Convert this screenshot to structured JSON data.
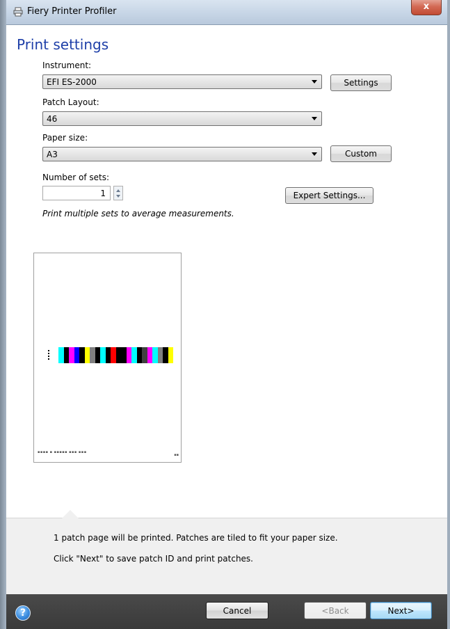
{
  "window": {
    "title": "Fiery Printer Profiler",
    "close_glyph": "x"
  },
  "page": {
    "title": "Print settings"
  },
  "instrument": {
    "label": "Instrument:",
    "value": "EFI ES-2000",
    "settings_button": "Settings"
  },
  "patch_layout": {
    "label": "Patch Layout:",
    "value": "46"
  },
  "paper_size": {
    "label": "Paper size:",
    "value": "A3",
    "custom_button": "Custom"
  },
  "sets": {
    "label": "Number of sets:",
    "value": "1",
    "hint": "Print multiple sets to average measurements.",
    "expert_button": "Expert Settings..."
  },
  "preview": {
    "patch_colors": [
      "#00ffff",
      "#000000",
      "#ff00ff",
      "#0000ff",
      "#000000",
      "#ffff00",
      "#808080",
      "#000000",
      "#00ffff",
      "#000000",
      "#ff0000",
      "#000000",
      "#000000",
      "#ff00ff",
      "#00ffff",
      "#000000",
      "#404040",
      "#ff00ff",
      "#00ffff",
      "#808080",
      "#000000",
      "#ffff00"
    ]
  },
  "info": {
    "line1": "1 patch page will be printed. Patches are tiled to fit your paper size.",
    "line2": "Click \"Next\" to save patch ID and print patches."
  },
  "footer": {
    "help_glyph": "?",
    "cancel": "Cancel",
    "back": "<Back",
    "next": "Next>"
  }
}
